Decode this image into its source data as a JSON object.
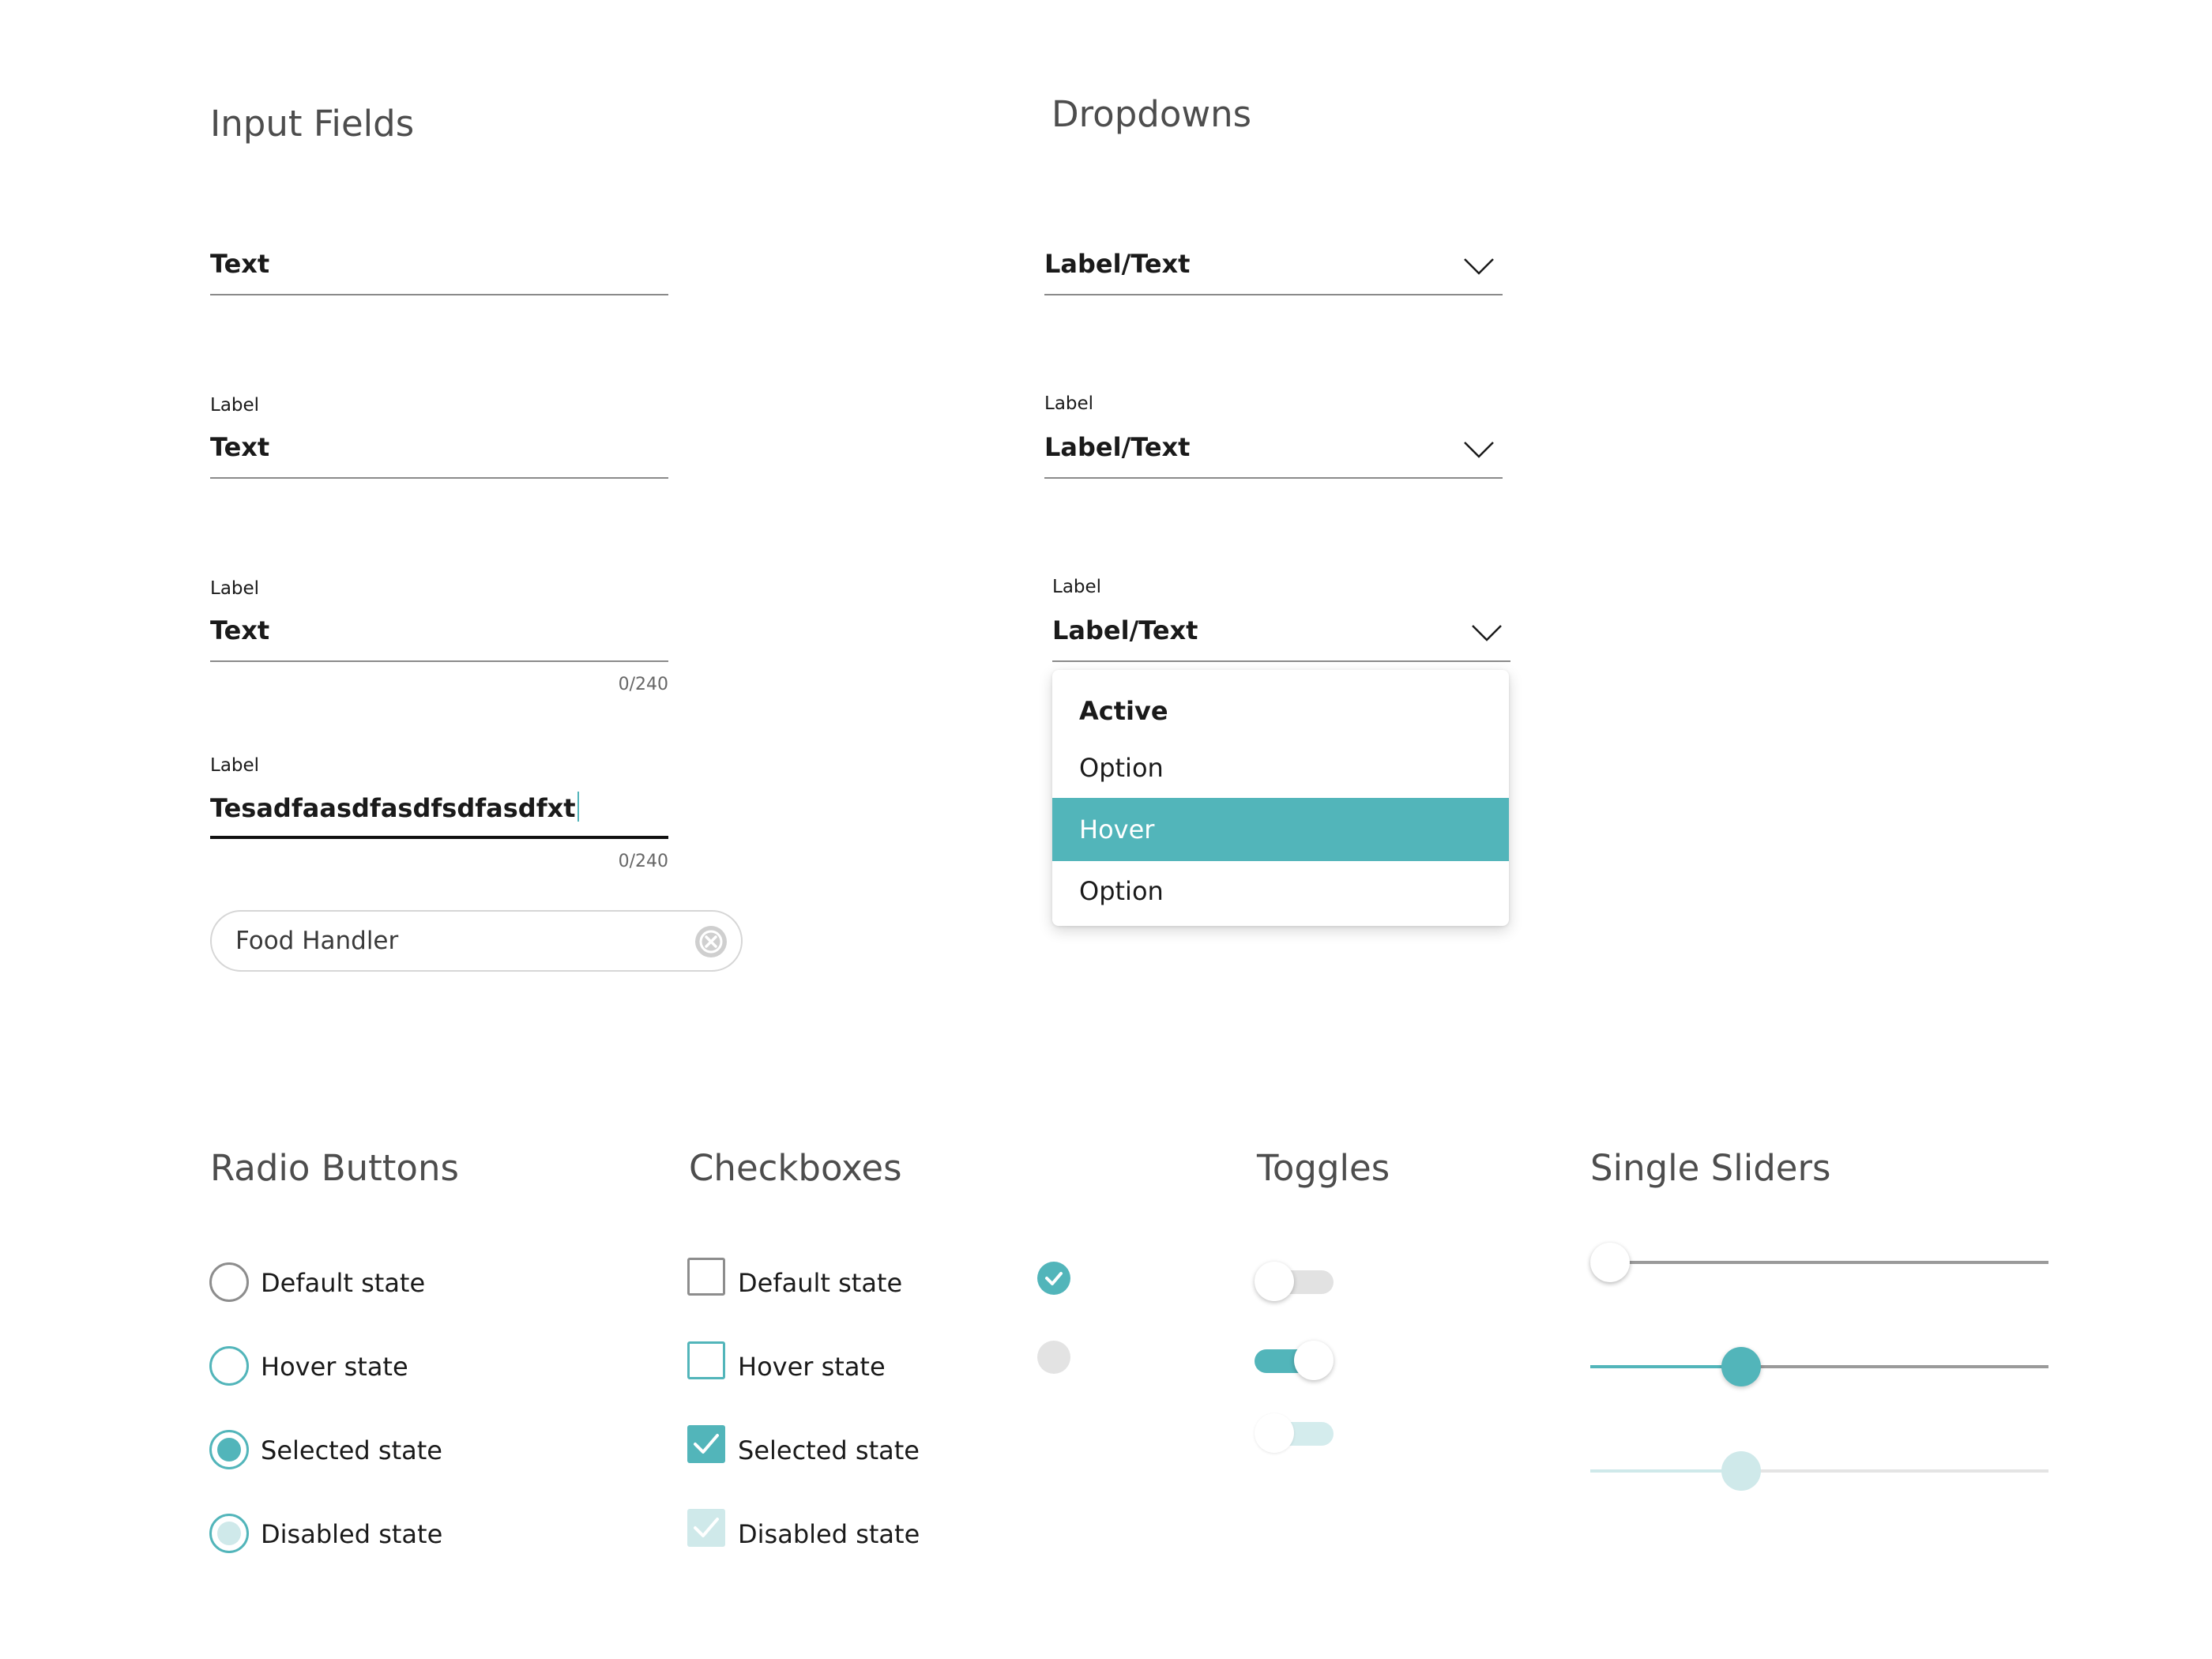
{
  "colors": {
    "accent": "#52b5ba",
    "accent_light": "#cfe9ea",
    "neutral_border": "#8d8d8d",
    "text": "#1a1a1a",
    "title_text": "#4d4d4d"
  },
  "sections": {
    "input_fields": "Input Fields",
    "dropdowns": "Dropdowns",
    "radio_buttons": "Radio Buttons",
    "checkboxes": "Checkboxes",
    "toggles": "Toggles",
    "single_sliders": "Single Sliders"
  },
  "inputs": [
    {
      "label": "",
      "value": "Text",
      "counter": ""
    },
    {
      "label": "Label",
      "value": "Text",
      "counter": ""
    },
    {
      "label": "Label",
      "value": "Text",
      "counter": "0/240"
    },
    {
      "label": "Label",
      "value": "Tesadfaasdfasdfsdfasdfxt",
      "counter": "0/240"
    }
  ],
  "search_chip": {
    "value": "Food Handler",
    "clear_icon": "close-circle-icon"
  },
  "dropdowns": [
    {
      "label": "",
      "value": "Label/Text",
      "icon": "chevron-down-icon"
    },
    {
      "label": "Label",
      "value": "Label/Text",
      "icon": "chevron-down-icon"
    },
    {
      "label": "Label",
      "value": "Label/Text",
      "icon": "chevron-down-icon"
    }
  ],
  "dropdown_menu": {
    "items": [
      {
        "label": "Active",
        "state": "active"
      },
      {
        "label": "Option",
        "state": "default"
      },
      {
        "label": "Hover",
        "state": "hover"
      },
      {
        "label": "Option",
        "state": "default"
      }
    ]
  },
  "radios": [
    {
      "label": "Default state",
      "state": "default"
    },
    {
      "label": "Hover state",
      "state": "hover"
    },
    {
      "label": "Selected state",
      "state": "selected"
    },
    {
      "label": "Disabled state",
      "state": "disabled"
    }
  ],
  "checkboxes": [
    {
      "label": "Default state",
      "state": "default"
    },
    {
      "label": "Hover state",
      "state": "hover"
    },
    {
      "label": "Selected state",
      "state": "selected"
    },
    {
      "label": "Disabled state",
      "state": "disabled"
    }
  ],
  "round_checks": [
    {
      "state": "checked",
      "icon": "check-circle-icon"
    },
    {
      "state": "disabled",
      "icon": "circle-icon"
    }
  ],
  "toggles": [
    {
      "state": "off"
    },
    {
      "state": "on"
    },
    {
      "state": "disabled"
    }
  ],
  "sliders": [
    {
      "value": 0,
      "state": "default"
    },
    {
      "value": 0.33,
      "state": "active"
    },
    {
      "value": 0.33,
      "state": "disabled"
    }
  ]
}
